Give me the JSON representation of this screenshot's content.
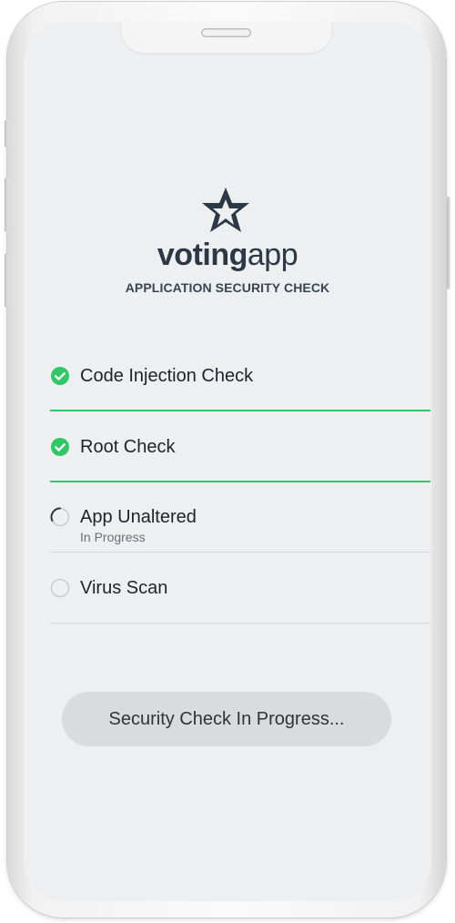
{
  "app": {
    "brand_bold": "voting",
    "brand_light": "app",
    "subtitle": "APPLICATION SECURITY CHECK",
    "logo_icon": "star-icon"
  },
  "checks": [
    {
      "label": "Code Injection Check",
      "status": "complete",
      "icon": "check-circle-icon"
    },
    {
      "label": "Root Check",
      "status": "complete",
      "icon": "check-circle-icon"
    },
    {
      "label": "App Unaltered",
      "status": "in-progress",
      "sub": "In Progress",
      "icon": "spinner-icon"
    },
    {
      "label": "Virus Scan",
      "status": "pending",
      "icon": "empty-circle-icon"
    }
  ],
  "button": {
    "label": "Security Check In Progress..."
  },
  "colors": {
    "success": "#2ec866",
    "brand_text": "#2c3845",
    "screen_bg": "#eeeff0",
    "button_bg": "#d9dbdd"
  }
}
